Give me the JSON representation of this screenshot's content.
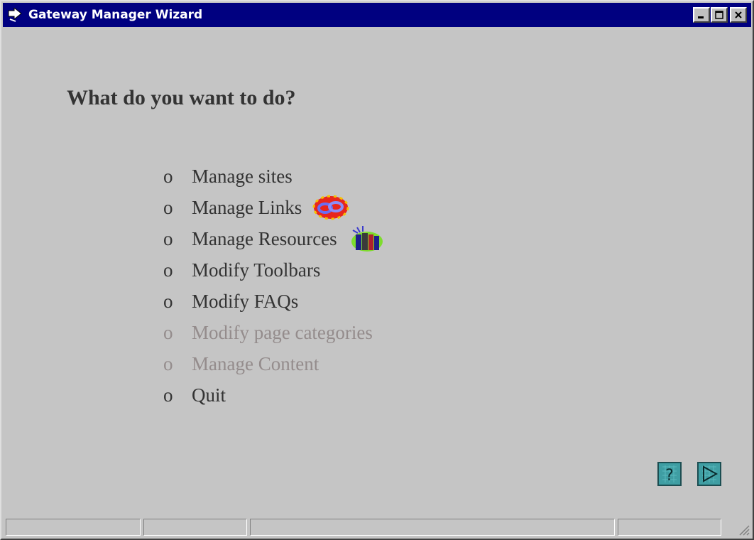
{
  "window": {
    "title": "Gateway Manager Wizard",
    "icon": "wizard-arrow-icon",
    "controls": [
      "minimize-icon",
      "maximize-icon",
      "close-icon"
    ]
  },
  "main": {
    "heading": "What do you want to do?",
    "bullet": "o",
    "items": [
      {
        "label": "Manage sites",
        "enabled": true
      },
      {
        "label": "Manage Links",
        "enabled": true,
        "icon": "chain-links-icon"
      },
      {
        "label": "Manage Resources",
        "enabled": true,
        "icon": "books-icon"
      },
      {
        "label": "Modify Toolbars",
        "enabled": true
      },
      {
        "label": "Modify FAQs",
        "enabled": true
      },
      {
        "label": "Modify page categories",
        "enabled": false
      },
      {
        "label": "Manage Content",
        "enabled": false
      },
      {
        "label": "Quit",
        "enabled": true
      }
    ]
  },
  "footer_buttons": {
    "help_icon": "help-icon",
    "next_icon": "next-arrow-icon"
  },
  "colors": {
    "titlebar": "#000080",
    "window_bg": "#c5c5c5",
    "text": "#333333",
    "disabled_text": "#948c8c",
    "button_teal": "#3f9ea3"
  }
}
